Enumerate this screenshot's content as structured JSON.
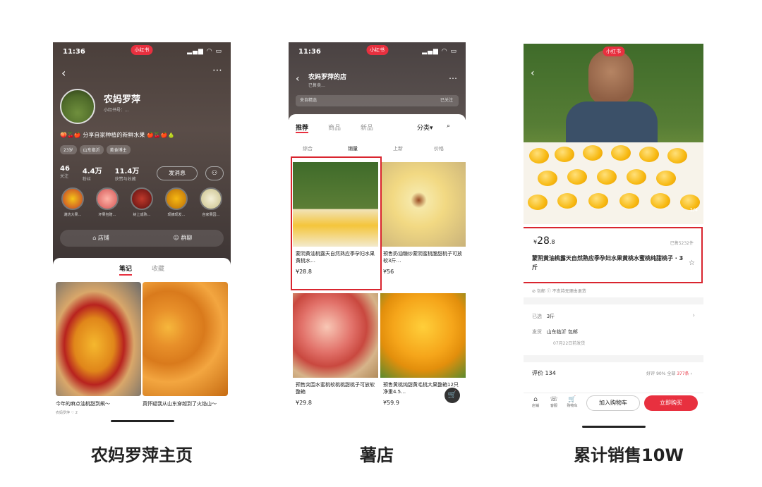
{
  "captions": [
    "农妈罗萍主页",
    "薯店",
    "累计销售10W"
  ],
  "status": {
    "time": "11:36",
    "badge": "小红书"
  },
  "profile": {
    "name": "农妈罗萍",
    "id_line": "小红书号：",
    "id_value": "...",
    "bio": "🍑🍒🍎 分享自家种植的新鲜水果 🍎🍒🍎🍐",
    "tags": [
      "23岁",
      "山东临沂",
      "美食博主"
    ],
    "stats": [
      {
        "n": "46",
        "l": "关注"
      },
      {
        "n": "4.4万",
        "l": "粉丝"
      },
      {
        "n": "11.4万",
        "l": "获赞与收藏"
      }
    ],
    "message_btn": "发消息",
    "circles": [
      "潍坊大果…",
      "坏果包赔…",
      "树上成熟…",
      "现摘现发…",
      "自家果园…"
    ],
    "shop_label": "店铺",
    "group_label": "群聊",
    "tabs": [
      "笔记",
      "收藏"
    ],
    "notes": [
      {
        "caption": "今年的麻点油桃甜到飙～",
        "author": "农妈罗萍",
        "likes": "2"
      },
      {
        "caption": "真怀疑我从山东穿越到了火焰山～",
        "author": "",
        "likes": ""
      }
    ]
  },
  "shop": {
    "name": "农妈罗萍的店",
    "sub": "已售卖…",
    "banner": "来自精选",
    "banner_right": "已关注",
    "tabs": [
      "推荐",
      "商品",
      "新品",
      "分类▾"
    ],
    "subtabs": [
      "综合",
      "销量",
      "上新",
      "价格"
    ],
    "products": [
      {
        "title": "蒙阴黄油桃露天自然熟应季孕妇水果黄桃水…",
        "price_prefix": "¥",
        "price": "28.8"
      },
      {
        "title": "预售奶油糖炒蒙阴蜜桃脆甜桃子可放软3斤…",
        "price_prefix": "¥",
        "price": "56"
      },
      {
        "title": "预售突围水蜜桃软桃桃甜桃子可放软整箱",
        "price_prefix": "¥",
        "price": "29.8"
      },
      {
        "title": "预售黄桃纯甜黄毛桃大果整箱12只净重4.5…",
        "price_prefix": "¥",
        "price": "59.9"
      }
    ]
  },
  "detail": {
    "price_prefix": "¥",
    "price": "28",
    "price_dec": ".8",
    "sold": "已售5232件",
    "title": "蒙阴黄油桃露天自然熟应季孕妇水果黄桃水蜜桃纯甜桃子 · 3斤",
    "services": "⊘ 包邮   ⓘ 不支持无理由退货",
    "spec_label": "已选",
    "spec_value": "3斤",
    "ship_label": "发货",
    "ship_value": "山东临沂    包邮",
    "ship_date": "07月22日前发货",
    "review_label": "评价 134",
    "review_stats_1": "好评 90%  全部 ",
    "review_stats_2": "377条",
    "bottom_icons": [
      "店铺",
      "客服",
      "购物车"
    ],
    "cart_btn": "加入购物车",
    "buy_btn": "立即购买",
    "page_indicator": "1/4"
  },
  "colors": {
    "accent": "#e8303f",
    "highlight_box": "#d9252f"
  }
}
